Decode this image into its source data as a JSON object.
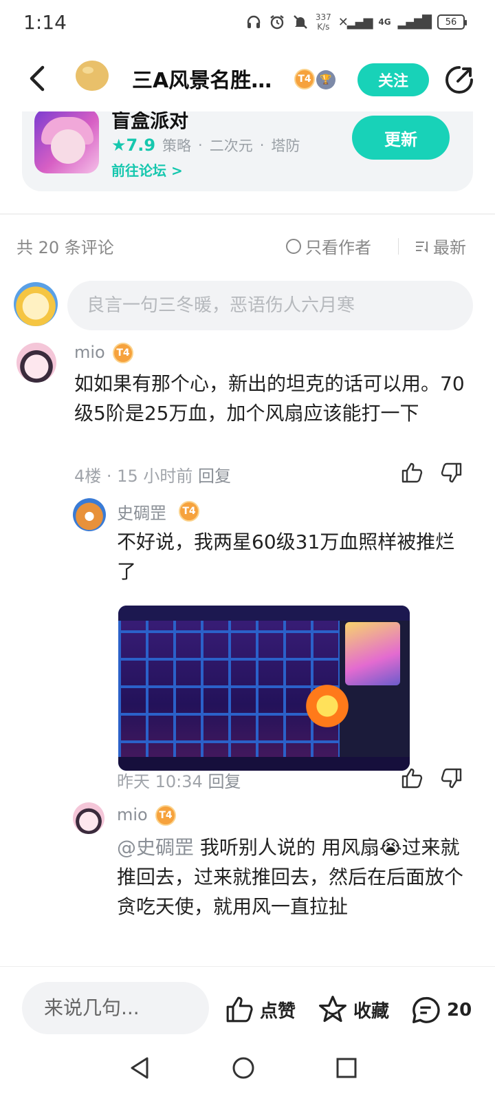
{
  "status_bar": {
    "time": "1:14",
    "net_speed_value": "337",
    "net_speed_unit": "K/s",
    "network": "4G",
    "battery": "56"
  },
  "header": {
    "title": "三A风景名胜…",
    "badge_level": "T4",
    "follow_label": "关注"
  },
  "game": {
    "name": "盲盒派对",
    "rating": "7.9",
    "tags": [
      "策略",
      "二次元",
      "塔防"
    ],
    "forum_link": "前往论坛 >",
    "update_label": "更新"
  },
  "comments_bar": {
    "count_text": "共 20 条评论",
    "author_only": "只看作者",
    "sort": "最新"
  },
  "input": {
    "placeholder": "良言一句三冬暖，恶语伤人六月寒"
  },
  "comments": [
    {
      "username": "mio",
      "badge": "T4",
      "text": "如如果有那个心，新出的坦克的话可以用。70级5阶是25万血，加个风扇应该能打一下",
      "floor": "4楼",
      "time": "15 小时前",
      "reply_label": "回复",
      "replies": [
        {
          "username": "史碉罡",
          "badge": "T4",
          "text": "不好说，我两星60级31万血照样被推烂了",
          "time": "昨天 10:34",
          "reply_label": "回复"
        },
        {
          "username": "mio",
          "badge": "T4",
          "mention": "@史碉罡",
          "text": " 我听别人说的 用风扇😭过来就推回去，过来就推回去，然后在后面放个贪吃天使，就用风一直拉扯"
        }
      ]
    }
  ],
  "bottom_bar": {
    "say_placeholder": "来说几句...",
    "like_label": "点赞",
    "fav_label": "收藏",
    "comment_count": "20"
  },
  "colors": {
    "accent": "#18d2b8",
    "badge": "#f6a23d"
  }
}
